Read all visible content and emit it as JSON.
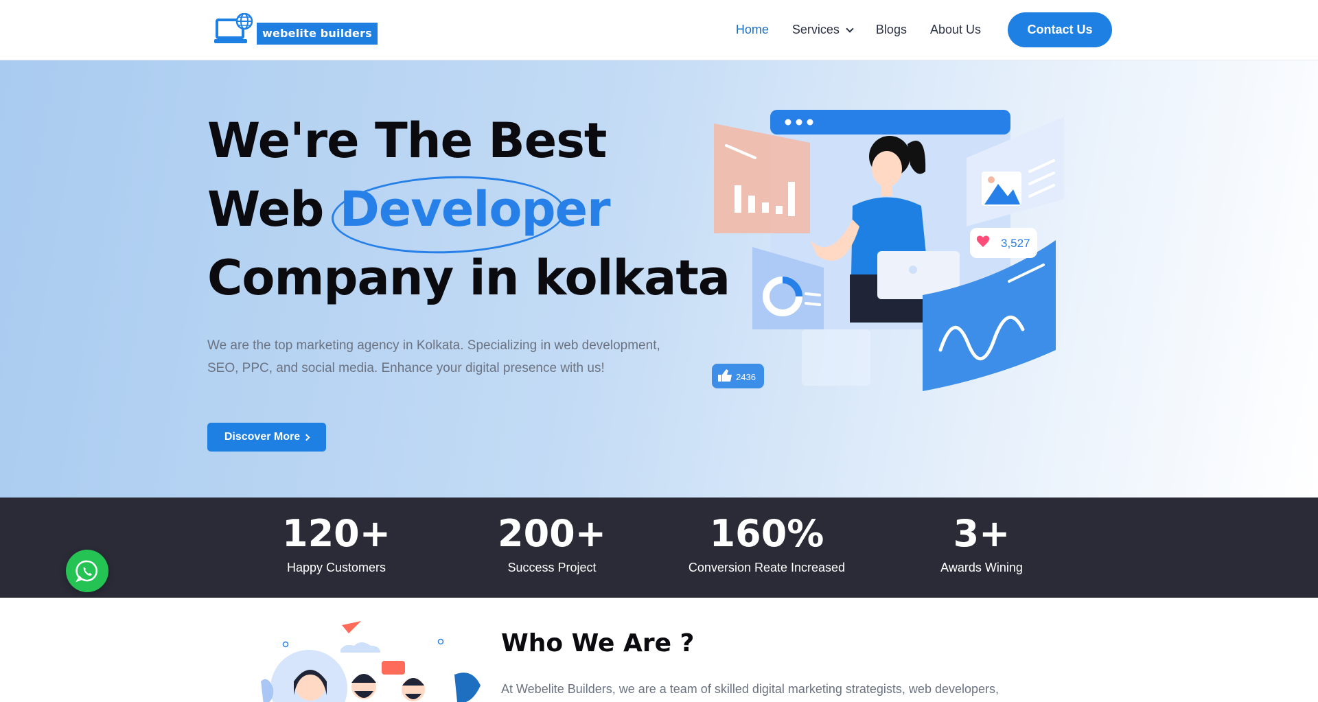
{
  "header": {
    "logo_text": "webelite builders",
    "nav": [
      {
        "label": "Home",
        "active": true
      },
      {
        "label": "Services",
        "has_dropdown": true
      },
      {
        "label": "Blogs"
      },
      {
        "label": "About Us"
      }
    ],
    "contact_label": "Contact Us"
  },
  "hero": {
    "title_line1": "We're The Best",
    "title_line2_prefix": "Web",
    "title_highlight": "Developer",
    "title_line3": "Company in kolkata",
    "description": "We are the top marketing agency in Kolkata. Specializing in web development, SEO, PPC, and social media. Enhance your digital presence with us!",
    "button_label": "Discover More",
    "illustration": {
      "likes_count": "3,527",
      "thumbs_count": "2436"
    }
  },
  "stats": [
    {
      "value": "120+",
      "label": "Happy Customers"
    },
    {
      "value": "200+",
      "label": "Success Project"
    },
    {
      "value": "160%",
      "label": "Conversion Reate Increased"
    },
    {
      "value": "3+",
      "label": "Awards Wining"
    }
  ],
  "who": {
    "title": "Who We Are ?",
    "text": "At Webelite Builders, we are a team of skilled digital marketing strategists, web developers,"
  },
  "colors": {
    "accent": "#1e80e3",
    "highlight": "#2680e8",
    "stats_bg": "#2b2b38",
    "whatsapp": "#25c254"
  }
}
